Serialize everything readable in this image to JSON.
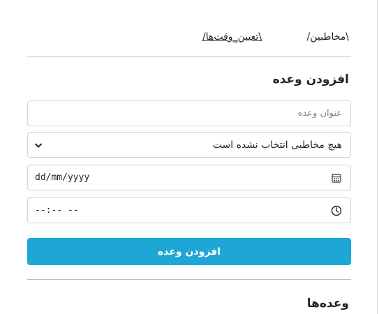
{
  "breadcrumb": {
    "contacts": "\\مخاطبین/",
    "appointments": "\\تعیین_وقت‌ها/"
  },
  "add_section": {
    "title": "افزودن وعده",
    "title_placeholder": "عنوان وعده",
    "contact_select_value": "هیچ مخاطبی انتخاب نشده است",
    "date_value": "dd/mm/yyyy",
    "time_value": "--:-- --",
    "submit_label": "افزودن وعده"
  },
  "list_section": {
    "title": "وعده‌ها"
  },
  "colors": {
    "accent": "#1ea7d6",
    "border": "#ced4da",
    "text": "#212529"
  }
}
